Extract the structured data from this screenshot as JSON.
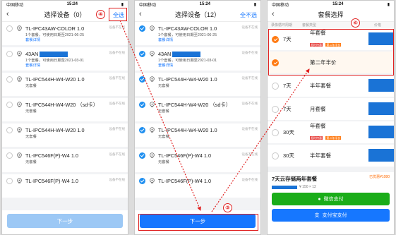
{
  "status": {
    "carrier": "中国移动",
    "time": "15:24"
  },
  "screen1": {
    "title": "选择设备（0）",
    "select_all": "全选",
    "step_badge": "④",
    "next": "下一步",
    "devices": [
      {
        "name": "TL-IPC43AW-COLOR 1.0",
        "tag": "设备不在线",
        "checked": false,
        "line1": "1个套餐，可使用日期至2021-06-25",
        "line2": "套餐详情"
      },
      {
        "name": "43AN",
        "tag": "设备不在线",
        "checked": false,
        "line1": "1个套餐，可使用日期至2021-03-01",
        "line2": "套餐详情",
        "redacted": true
      },
      {
        "name": "TL-IPC544H-W4-W20 1.0",
        "tag": "设备不在线",
        "checked": false,
        "line1": "无套餐"
      },
      {
        "name": "TL-IPC544H-W4-W20 （sd卡）",
        "tag": "设备不在线",
        "checked": false,
        "line1": "无套餐"
      },
      {
        "name": "TL-IPC544H-W4-W20 1.0",
        "tag": "设备不在线",
        "checked": false,
        "line1": "无套餐"
      },
      {
        "name": "TL-IPC546F(P)-W4 1.0",
        "tag": "设备不在线",
        "checked": false,
        "line1": "无套餐"
      },
      {
        "name": "TL-IPC546F(P)-W4 1.0",
        "tag": "设备不在线",
        "checked": false,
        "line1": ""
      }
    ]
  },
  "screen2": {
    "title": "选择设备（12）",
    "select_none": "全不选",
    "step_badge": "⑤",
    "next": "下一步",
    "devices": [
      {
        "name": "TL-IPC43AW-COLOR 1.0",
        "tag": "设备不在线",
        "checked": true,
        "line1": "1个套餐，可使用日期至2021-06-25",
        "line2": "套餐详情"
      },
      {
        "name": "43AN",
        "tag": "设备不在线",
        "checked": true,
        "line1": "1个套餐，可使用日期至2021-03-01",
        "line2": "套餐详情",
        "redacted": true
      },
      {
        "name": "TL-IPC544H-W4-W20 1.0",
        "tag": "设备不在线",
        "checked": true,
        "line1": "无套餐"
      },
      {
        "name": "TL-IPC544H-W4-W20 （sd卡）",
        "tag": "设备不在线",
        "checked": true,
        "line1": "无套餐"
      },
      {
        "name": "TL-IPC544H-W4-W20 1.0",
        "tag": "设备不在线",
        "checked": true,
        "line1": "无套餐"
      },
      {
        "name": "TL-IPC546F(P)-W4 1.0",
        "tag": "设备不在线",
        "checked": true,
        "line1": "无套餐"
      },
      {
        "name": "TL-IPC546F(P)-W4 1.0",
        "tag": "设备不在线",
        "checked": true,
        "line1": ""
      }
    ]
  },
  "screen3": {
    "title": "套餐选择",
    "step_badge": "⑥",
    "col_headers": [
      "录像循环周期",
      "套餐类型",
      "价格"
    ],
    "packages": [
      {
        "days": "7天",
        "name": "年套餐",
        "promo": "限时特惠",
        "promo2": "第二年半价",
        "checked": true
      },
      {
        "days": "",
        "name": "第二年半价",
        "checked": true,
        "sub": true
      },
      {
        "days": "7天",
        "name": "半年套餐",
        "checked": false
      },
      {
        "days": "7天",
        "name": "月套餐",
        "checked": false
      },
      {
        "days": "30天",
        "name": "年套餐",
        "promo": "限时特惠",
        "promo2": "第二年半价",
        "checked": false
      },
      {
        "days": "30天",
        "name": "半年套餐",
        "checked": false
      }
    ],
    "summary_title": "7天云存储两年套餐",
    "summary_line": "¥ 150 × 12",
    "discount": "已优惠¥1080",
    "wechat": "微信支付",
    "alipay": "支付宝支付"
  },
  "colors": {
    "accent": "#1677ff",
    "orange": "#ff7a12",
    "annotation": "#e02020",
    "wechat": "#1aad19"
  }
}
